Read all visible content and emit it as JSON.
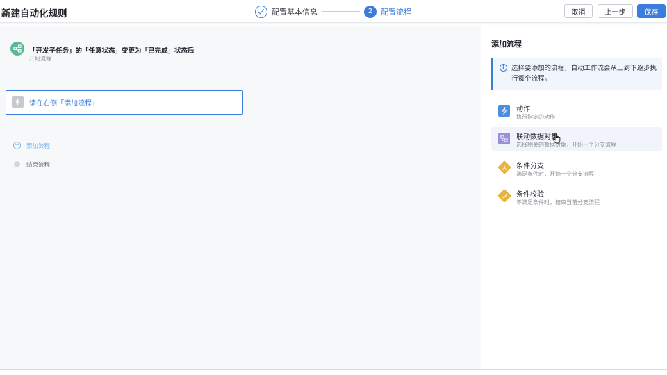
{
  "header": {
    "title": "新建自动化规则",
    "steps": [
      {
        "label": "配置基本信息",
        "state": "done"
      },
      {
        "number": "2",
        "label": "配置流程",
        "state": "active"
      }
    ],
    "buttons": {
      "cancel": "取消",
      "prev": "上一步",
      "save": "保存"
    },
    "accent_color": "#3b7ddd"
  },
  "canvas": {
    "trigger": {
      "icon": "share-nodes-icon",
      "title": "「开发子任务」的「任意状态」变更为「已完成」状态后",
      "subtitle": "开始流程"
    },
    "placeholder": {
      "icon": "diamond-placeholder-icon",
      "text": "请在右侧「添加流程」"
    },
    "add_flow_label": "添加流程",
    "end_flow_label": "结束流程"
  },
  "panel": {
    "title": "添加流程",
    "info": "选择要添加的流程，自动工作流会从上到下逐步执行每个流程。",
    "options": [
      {
        "icon": "lightning-icon",
        "title": "动作",
        "desc": "执行指定的动作",
        "color": "#4a90e2"
      },
      {
        "icon": "linked-object-icon",
        "title": "联动数据对象",
        "desc": "选择相关的数据对象，开始一个分支流程",
        "color": "#9b8fd8"
      },
      {
        "icon": "branch-icon",
        "title": "条件分支",
        "desc": "满足条件时，开始一个分支流程",
        "color": "#e7b43e"
      },
      {
        "icon": "condition-check-icon",
        "title": "条件校验",
        "desc": "不满足条件时，结束当前分支流程",
        "color": "#e7b43e"
      }
    ]
  }
}
